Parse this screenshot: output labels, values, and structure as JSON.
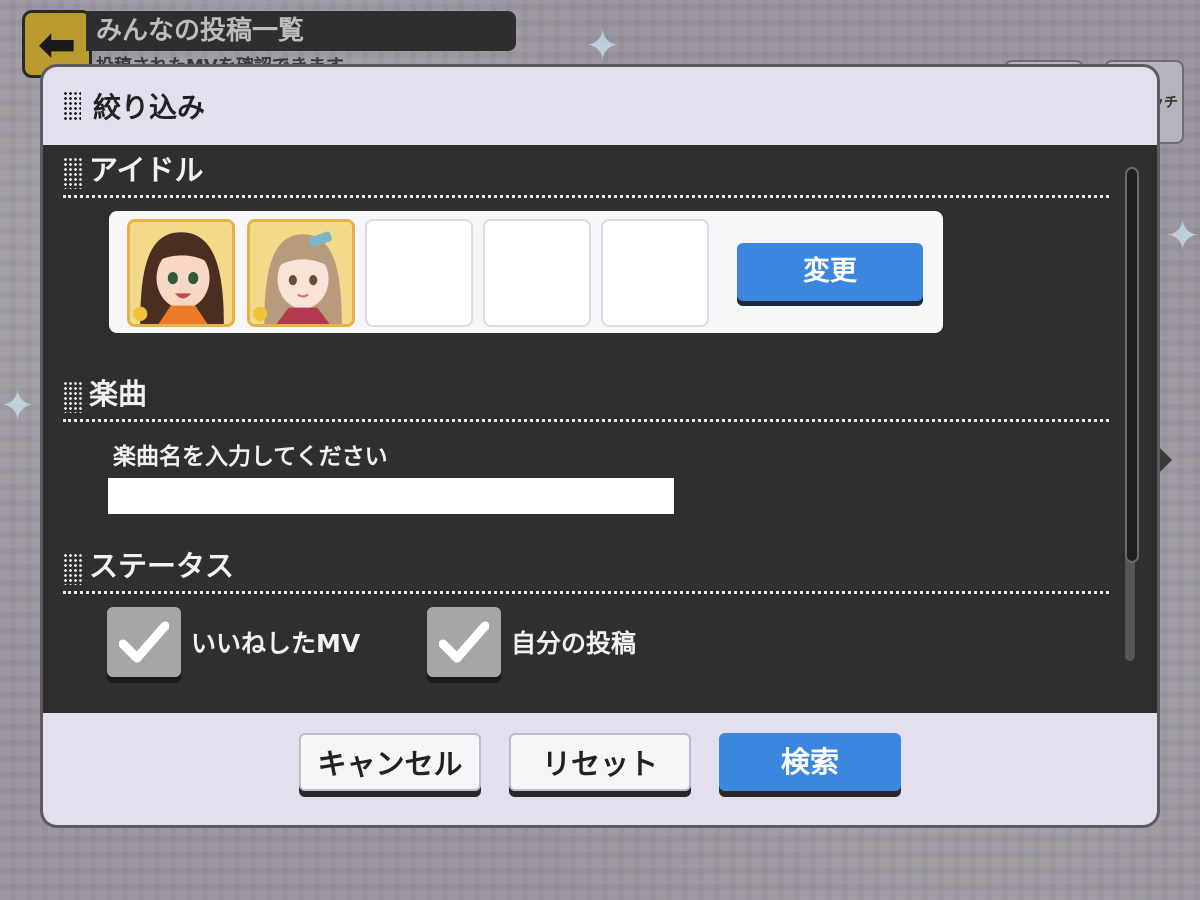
{
  "background": {
    "header_title": "みんなの投稿一覧",
    "header_subtitle": "投稿されたMVを確認できます",
    "side_chip_text": "ッチ"
  },
  "modal": {
    "title": "絞り込み",
    "sections": {
      "idol": {
        "title": "アイドル",
        "change_label": "変更"
      },
      "song": {
        "title": "楽曲",
        "prompt": "楽曲名を入力してください",
        "input_value": ""
      },
      "status": {
        "title": "ステータス",
        "options": [
          {
            "label": "いいねしたMV",
            "checked": true
          },
          {
            "label": "自分の投稿",
            "checked": true
          }
        ]
      }
    },
    "buttons": {
      "cancel": "キャンセル",
      "reset": "リセット",
      "search": "検索"
    }
  },
  "colors": {
    "accent_blue": "#3d86e0",
    "modal_bg": "#e2dfee",
    "content_bg": "#2f2f2f",
    "gold": "#e5b24a"
  },
  "icons": [
    "back-arrow-icon",
    "grip-icon",
    "checkmark-icon",
    "idol-avatar-icon"
  ]
}
